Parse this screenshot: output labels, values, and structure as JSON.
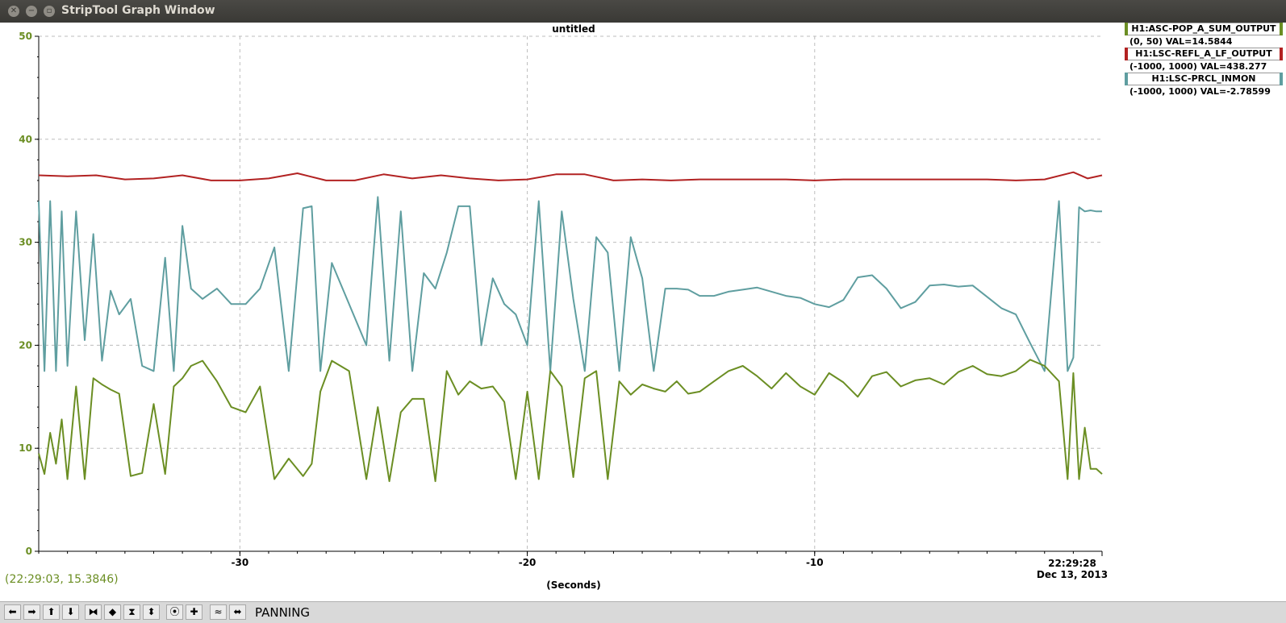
{
  "window": {
    "title": "StripTool Graph Window",
    "close_icon": "close-icon",
    "minimize_icon": "minimize-icon",
    "maximize_icon": "maximize-icon"
  },
  "graph": {
    "title": "untitled",
    "coord_readout": "(22:29:03, 15.3846)",
    "x_axis_label": "(Seconds)",
    "time_label": "22:29:28",
    "date_label": "Dec 13, 2013"
  },
  "legend": [
    {
      "name": "H1:ASC-POP_A_SUM_OUTPUT",
      "range": "(0, 50) VAL=14.5844",
      "color": "#6b8e23"
    },
    {
      "name": "H1:LSC-REFL_A_LF_OUTPUT",
      "range": "(-1000, 1000) VAL=438.277",
      "color": "#b22222"
    },
    {
      "name": "H1:LSC-PRCL_INMON",
      "range": "(-1000, 1000) VAL=-2.78599",
      "color": "#5f9ea0"
    }
  ],
  "toolbar": {
    "mode": "PANNING",
    "buttons": [
      {
        "icon": "arrow-left-icon",
        "glyph": "⬅"
      },
      {
        "icon": "arrow-right-icon",
        "glyph": "➡"
      },
      {
        "icon": "arrow-up-icon",
        "glyph": "⬆"
      },
      {
        "icon": "arrow-down-icon",
        "glyph": "⬇"
      },
      {
        "icon": "zoom-in-x-icon",
        "glyph": "⧓"
      },
      {
        "icon": "zoom-out-x-icon",
        "glyph": "◆"
      },
      {
        "icon": "zoom-in-y-icon",
        "glyph": "⧗"
      },
      {
        "icon": "zoom-out-y-icon",
        "glyph": "⬍"
      },
      {
        "icon": "record-icon",
        "glyph": "⦿"
      },
      {
        "icon": "plus-icon",
        "glyph": "✚"
      },
      {
        "icon": "auto-scale-icon",
        "glyph": "≈"
      },
      {
        "icon": "pan-icon",
        "glyph": "⬌"
      }
    ]
  },
  "chart_data": {
    "type": "line",
    "title": "untitled",
    "xlabel": "(Seconds)",
    "ylabel": "",
    "xlim": [
      -37,
      0
    ],
    "ylim": [
      0,
      50
    ],
    "x_ticks": [
      -30,
      -20,
      -10
    ],
    "y_ticks": [
      0,
      10,
      20,
      30,
      40,
      50
    ],
    "grid": true,
    "legend_position": "top-right",
    "series": [
      {
        "name": "H1:LSC-REFL_A_LF_OUTPUT",
        "color": "#b22222",
        "x": [
          -37,
          -36,
          -35,
          -34,
          -33,
          -32,
          -31,
          -30,
          -29,
          -28,
          -27,
          -26,
          -25,
          -24,
          -23,
          -22,
          -21,
          -20,
          -19,
          -18,
          -17,
          -16,
          -15,
          -14,
          -13,
          -12,
          -11,
          -10,
          -9,
          -8,
          -7,
          -6,
          -5,
          -4,
          -3,
          -2,
          -1,
          -0.5,
          0
        ],
        "y": [
          36.5,
          36.4,
          36.5,
          36.1,
          36.2,
          36.5,
          36.0,
          36.0,
          36.2,
          36.7,
          36.0,
          36.0,
          36.6,
          36.2,
          36.5,
          36.2,
          36.0,
          36.1,
          36.6,
          36.6,
          36.0,
          36.1,
          36.0,
          36.1,
          36.1,
          36.1,
          36.1,
          36.0,
          36.1,
          36.1,
          36.1,
          36.1,
          36.1,
          36.1,
          36.0,
          36.1,
          36.8,
          36.2,
          36.5
        ]
      },
      {
        "name": "H1:LSC-PRCL_INMON",
        "color": "#5f9ea0",
        "x": [
          -37,
          -36.8,
          -36.6,
          -36.4,
          -36.2,
          -36.0,
          -35.7,
          -35.4,
          -35.1,
          -34.8,
          -34.5,
          -34.2,
          -33.8,
          -33.4,
          -33.0,
          -32.6,
          -32.3,
          -32.0,
          -31.7,
          -31.3,
          -30.8,
          -30.3,
          -29.8,
          -29.3,
          -28.8,
          -28.3,
          -27.8,
          -27.5,
          -27.2,
          -26.8,
          -26.2,
          -25.6,
          -25.2,
          -24.8,
          -24.4,
          -24.0,
          -23.6,
          -23.2,
          -22.8,
          -22.4,
          -22.0,
          -21.6,
          -21.2,
          -20.8,
          -20.4,
          -20.0,
          -19.6,
          -19.2,
          -18.8,
          -18.4,
          -18.0,
          -17.6,
          -17.2,
          -16.8,
          -16.4,
          -16.0,
          -15.6,
          -15.2,
          -14.8,
          -14.4,
          -14.0,
          -13.5,
          -13.0,
          -12.5,
          -12.0,
          -11.5,
          -11.0,
          -10.5,
          -10.0,
          -9.5,
          -9.0,
          -8.5,
          -8.0,
          -7.5,
          -7.0,
          -6.5,
          -6.0,
          -5.5,
          -5.0,
          -4.5,
          -4.0,
          -3.5,
          -3.0,
          -2.5,
          -2.0,
          -1.5,
          -1.2,
          -1.0,
          -0.8,
          -0.6,
          -0.4,
          -0.2,
          0
        ],
        "y": [
          34,
          17.5,
          34,
          17.5,
          33,
          18,
          33,
          20.5,
          30.8,
          18.5,
          25.3,
          23,
          24.5,
          18,
          17.5,
          28.5,
          17.5,
          31.6,
          25.5,
          24.5,
          25.5,
          24,
          24,
          25.5,
          29.5,
          17.5,
          33.3,
          33.5,
          17.5,
          28,
          24,
          20,
          34.4,
          18.5,
          33,
          17.5,
          27,
          25.5,
          29,
          33.5,
          33.5,
          20,
          26.5,
          24,
          23,
          20,
          34,
          17.5,
          33,
          24.5,
          17.5,
          30.5,
          29,
          17.5,
          30.5,
          26.5,
          17.5,
          25.5,
          25.5,
          25.4,
          24.8,
          24.8,
          25.2,
          25.4,
          25.6,
          25.2,
          24.8,
          24.6,
          24.0,
          23.7,
          24.4,
          26.6,
          26.8,
          25.5,
          23.6,
          24.2,
          25.8,
          25.9,
          25.7,
          25.8,
          24.7,
          23.6,
          23.0,
          20.2,
          17.5,
          34,
          17.5,
          18.8,
          33.4,
          33.0,
          33.1,
          33.0,
          33.0
        ]
      },
      {
        "name": "H1:ASC-POP_A_SUM_OUTPUT",
        "color": "#6b8e23",
        "x": [
          -37,
          -36.8,
          -36.6,
          -36.4,
          -36.2,
          -36.0,
          -35.7,
          -35.4,
          -35.1,
          -34.8,
          -34.5,
          -34.2,
          -33.8,
          -33.4,
          -33.0,
          -32.6,
          -32.3,
          -32.0,
          -31.7,
          -31.3,
          -30.8,
          -30.3,
          -29.8,
          -29.3,
          -28.8,
          -28.3,
          -27.8,
          -27.5,
          -27.2,
          -26.8,
          -26.2,
          -25.6,
          -25.2,
          -24.8,
          -24.4,
          -24.0,
          -23.6,
          -23.2,
          -22.8,
          -22.4,
          -22.0,
          -21.6,
          -21.2,
          -20.8,
          -20.4,
          -20.0,
          -19.6,
          -19.2,
          -18.8,
          -18.4,
          -18.0,
          -17.6,
          -17.2,
          -16.8,
          -16.4,
          -16.0,
          -15.6,
          -15.2,
          -14.8,
          -14.4,
          -14.0,
          -13.5,
          -13.0,
          -12.5,
          -12.0,
          -11.5,
          -11.0,
          -10.5,
          -10.0,
          -9.5,
          -9.0,
          -8.5,
          -8.0,
          -7.5,
          -7.0,
          -6.5,
          -6.0,
          -5.5,
          -5.0,
          -4.5,
          -4.0,
          -3.5,
          -3.0,
          -2.5,
          -2.0,
          -1.5,
          -1.2,
          -1.0,
          -0.8,
          -0.6,
          -0.4,
          -0.2,
          0
        ],
        "y": [
          9.5,
          7.5,
          11.5,
          8.5,
          12.8,
          7,
          16,
          7,
          16.8,
          16.2,
          15.7,
          15.3,
          7.3,
          7.6,
          14.3,
          7.5,
          16.0,
          16.8,
          18.0,
          18.5,
          16.5,
          14.0,
          13.5,
          16.0,
          7.0,
          9.0,
          7.3,
          8.5,
          15.5,
          18.5,
          17.5,
          7.0,
          14.0,
          6.8,
          13.5,
          14.8,
          14.8,
          6.8,
          17.5,
          15.2,
          16.5,
          15.8,
          16.0,
          14.5,
          7.0,
          15.5,
          7.0,
          17.5,
          16.0,
          7.2,
          16.8,
          17.5,
          7.0,
          16.5,
          15.2,
          16.2,
          15.8,
          15.5,
          16.5,
          15.3,
          15.5,
          16.5,
          17.5,
          18.0,
          17.0,
          15.8,
          17.3,
          16.0,
          15.2,
          17.3,
          16.4,
          15.0,
          17.0,
          17.4,
          16.0,
          16.6,
          16.8,
          16.2,
          17.4,
          18.0,
          17.2,
          17.0,
          17.5,
          18.6,
          18.0,
          16.5,
          7.0,
          17.3,
          7.0,
          12.0,
          8.0,
          8.0,
          7.5
        ]
      }
    ]
  }
}
